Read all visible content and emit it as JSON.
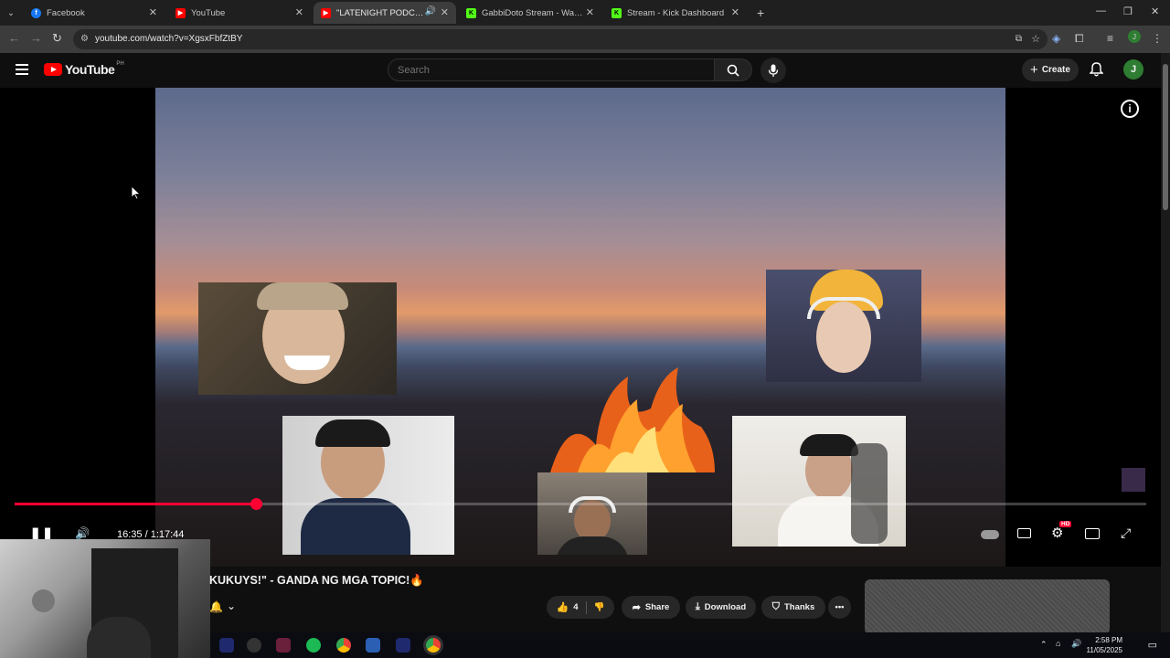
{
  "browser": {
    "tabs": [
      {
        "label": "Facebook",
        "favicon": "facebook-icon",
        "color": "#1877f2"
      },
      {
        "label": "YouTube",
        "favicon": "youtube-icon",
        "color": "#ff0000"
      },
      {
        "label": "\"LATENIGHT PODCAST with",
        "favicon": "youtube-icon",
        "color": "#ff0000",
        "active": true
      },
      {
        "label": "GabbiDoto Stream - Watch Live",
        "favicon": "kick-icon",
        "color": "#53fc18"
      },
      {
        "label": "Stream - Kick Dashboard",
        "favicon": "kick-icon",
        "color": "#53fc18"
      }
    ],
    "url": "youtube.com/watch?v=XgsxFbfZtBY"
  },
  "youtube": {
    "logo_text": "YouTube",
    "region": "PH",
    "search_placeholder": "Search",
    "create_label": "Create",
    "avatar_initial": "J"
  },
  "player": {
    "current_time": "16:35",
    "duration": "1:17:44",
    "timecode": "16:35 / 1:17:44",
    "progress_fraction": 0.213,
    "hd_badge": "HD"
  },
  "video": {
    "title_visible": "KUKUYS!\" - GANDA NG MGA TOPIC!🔥",
    "like_count": "4",
    "share_label": "Share",
    "download_label": "Download",
    "thanks_label": "Thanks"
  },
  "taskbar": {
    "time": "2:58 PM",
    "date": "11/05/2025"
  },
  "colors": {
    "accent_red": "#ff0033",
    "youtube_red": "#ff0000",
    "avatar_green": "#2e7d32"
  }
}
